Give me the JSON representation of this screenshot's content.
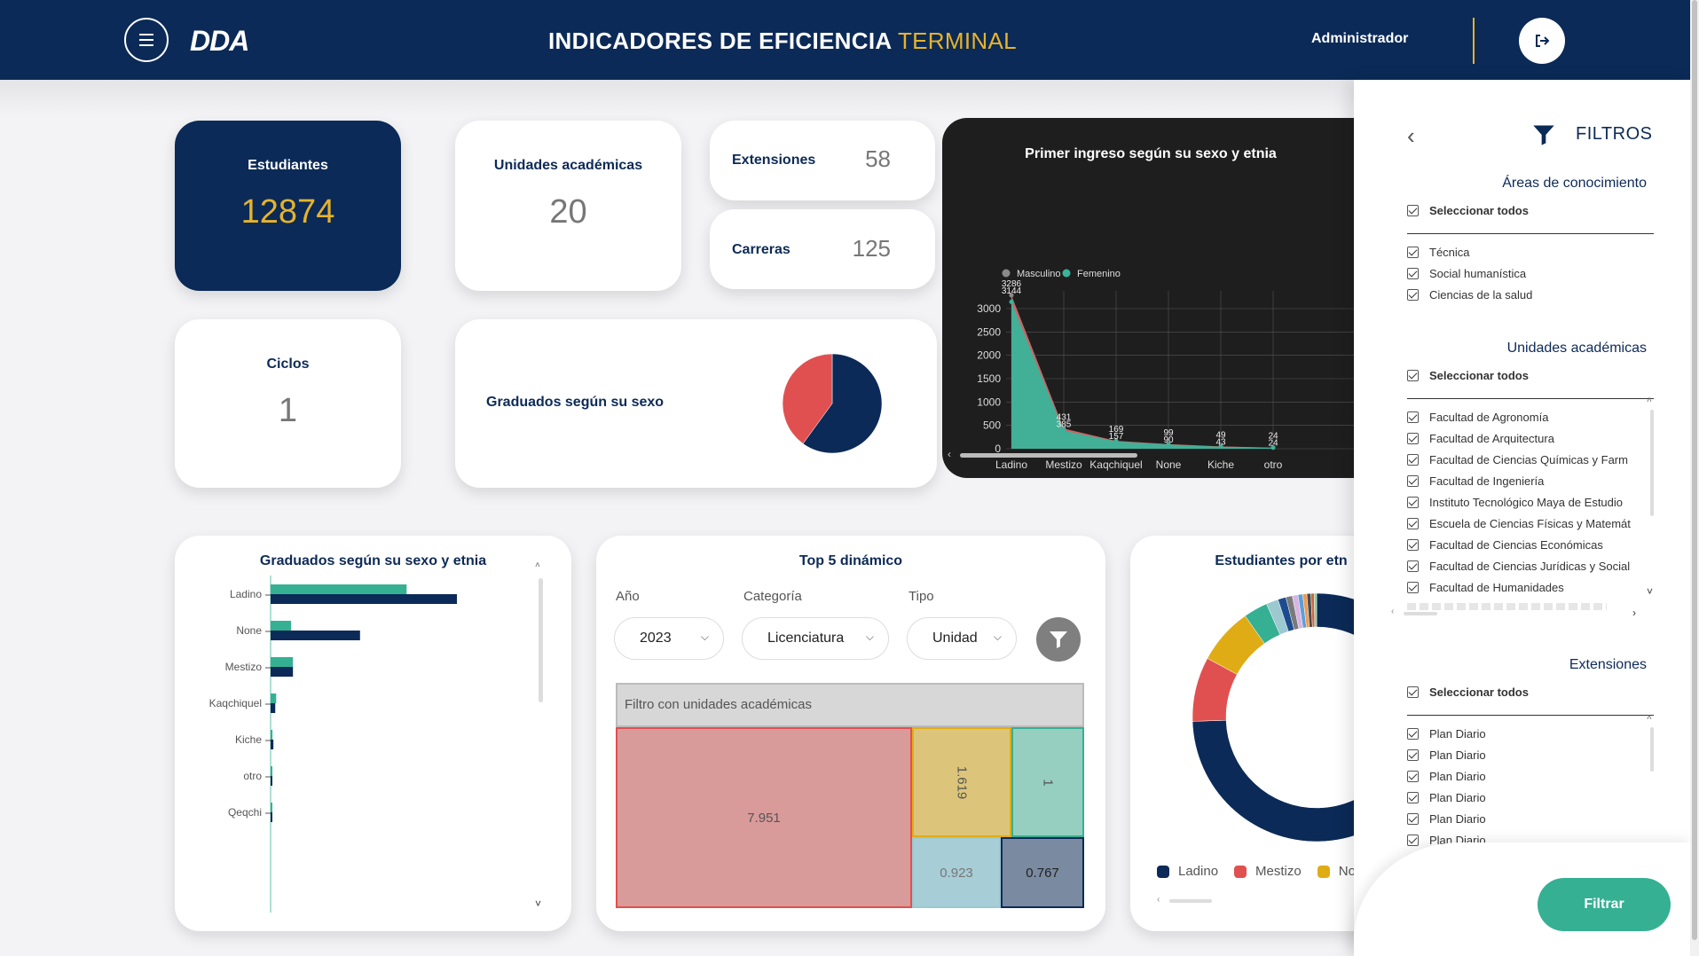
{
  "header": {
    "logo": "DDA",
    "title_main": "INDICADORES DE EFICIENCIA ",
    "title_accent": "TERMINAL",
    "user": "Administrador"
  },
  "kpis": {
    "estudiantes": {
      "label": "Estudiantes",
      "value": "12874"
    },
    "unidades": {
      "label": "Unidades académicas",
      "value": "20"
    },
    "extensiones": {
      "label": "Extensiones",
      "value": "58"
    },
    "carreras": {
      "label": "Carreras",
      "value": "125"
    },
    "ciclos": {
      "label": "Ciclos",
      "value": "1"
    }
  },
  "graduados_sexo": {
    "label": "Graduados según su sexo"
  },
  "chart_data": [
    {
      "type": "pie",
      "id": "graduados-sexo",
      "values": [
        60,
        40
      ],
      "colors": [
        "#0b2a57",
        "#e05050"
      ]
    },
    {
      "type": "area",
      "id": "primer-ingreso",
      "title": "Primer ingreso según su sexo y etnia",
      "categories": [
        "Ladino",
        "Mestizo",
        "Kaqchiquel",
        "None",
        "Kiche",
        "otro"
      ],
      "series": [
        {
          "name": "Masculino",
          "values": [
            3286,
            431,
            169,
            99,
            49,
            24
          ],
          "color": "#8a8a8a"
        },
        {
          "name": "Femenino",
          "values": [
            3144,
            385,
            157,
            90,
            43,
            24
          ],
          "color": "#3ab39a"
        }
      ],
      "ylim": [
        0,
        3000
      ],
      "yticks": [
        "0",
        "500",
        "1000",
        "1500",
        "2000",
        "2500",
        "3000"
      ],
      "labels_top": [
        "3286",
        "431",
        "169",
        "99",
        "49",
        "24"
      ],
      "labels_bottom": [
        "3144",
        "385",
        "157",
        "90",
        "43",
        "24"
      ]
    },
    {
      "type": "bar",
      "id": "graduados-etnia",
      "title": "Graduados según su sexo y etnia",
      "categories": [
        "Ladino",
        "None",
        "Mestizo",
        "Kaqchiquel",
        "Kiche",
        "otro",
        "Qeqchi"
      ],
      "series": [
        {
          "values": [
            730,
            110,
            120,
            30,
            10,
            8,
            6
          ],
          "color": "#35b093"
        },
        {
          "values": [
            1000,
            480,
            120,
            25,
            15,
            5,
            5
          ],
          "color": "#0b2a57"
        }
      ]
    },
    {
      "type": "pie",
      "id": "estudiantes-etnia",
      "title": "Estudiantes por etn",
      "values": [
        71,
        8,
        7,
        3,
        1.5,
        1,
        0.8,
        0.7,
        0.6,
        0.5,
        0.5,
        0.4,
        0.3
      ],
      "colors": [
        "#0b2a57",
        "#e05050",
        "#e0ac15",
        "#35b093",
        "#9cc8d0",
        "#1d4b8f",
        "#7a7a7a",
        "#d8b4e2",
        "#5e9fd8",
        "#f09a50",
        "#4b4b4b",
        "#c64",
        "#8c8"
      ],
      "legend": [
        {
          "name": "Ladino",
          "color": "#0b2a57"
        },
        {
          "name": "Mestizo",
          "color": "#e05050"
        },
        {
          "name": "No",
          "color": "#e0ac15"
        }
      ]
    }
  ],
  "top5": {
    "title": "Top 5 dinámico",
    "year_label": "Año",
    "year_value": "2023",
    "category_label": "Categoría",
    "category_value": "Licenciatura",
    "type_label": "Tipo",
    "type_value": "Unidad",
    "treemap_header": "Filtro con unidades académicas",
    "cells": [
      {
        "value": "7.951",
        "color": "#d99a9a",
        "border": "#e05050"
      },
      {
        "value": "1.619",
        "color": "#dcc57a",
        "border": "#e0ac15"
      },
      {
        "value": "1",
        "color": "#96cfc0",
        "border": "#35b093"
      },
      {
        "value": "0.923",
        "color": "#a7cdd6",
        "border": "#9cc8d0"
      },
      {
        "value": "0.767",
        "color": "#7a8aa0",
        "border": "#0b2a57"
      }
    ]
  },
  "filters": {
    "title": "FILTROS",
    "sections": {
      "areas": {
        "title": "Áreas de conocimiento",
        "select_all": "Seleccionar todos",
        "items": [
          "Técnica",
          "Social humanística",
          "Ciencias de la salud"
        ]
      },
      "unidades": {
        "title": "Unidades académicas",
        "select_all": "Seleccionar todos",
        "items": [
          "Facultad de Agronomía",
          "Facultad de Arquitectura",
          "Facultad de Ciencias Químicas y Farm",
          "Facultad de Ingeniería",
          "Instituto Tecnológico Maya de Estudio",
          "Escuela de Ciencias Físicas y Matemát",
          "Facultad de Ciencias Económicas",
          "Facultad de Ciencias Jurídicas y Social",
          "Facultad de Humanidades"
        ]
      },
      "extensiones": {
        "title": "Extensiones",
        "select_all": "Seleccionar todos",
        "items": [
          "Plan Diario",
          "Plan Diario",
          "Plan Diario",
          "Plan Diario",
          "Plan Diario",
          "Plan Diario"
        ]
      }
    },
    "button": "Filtrar"
  }
}
